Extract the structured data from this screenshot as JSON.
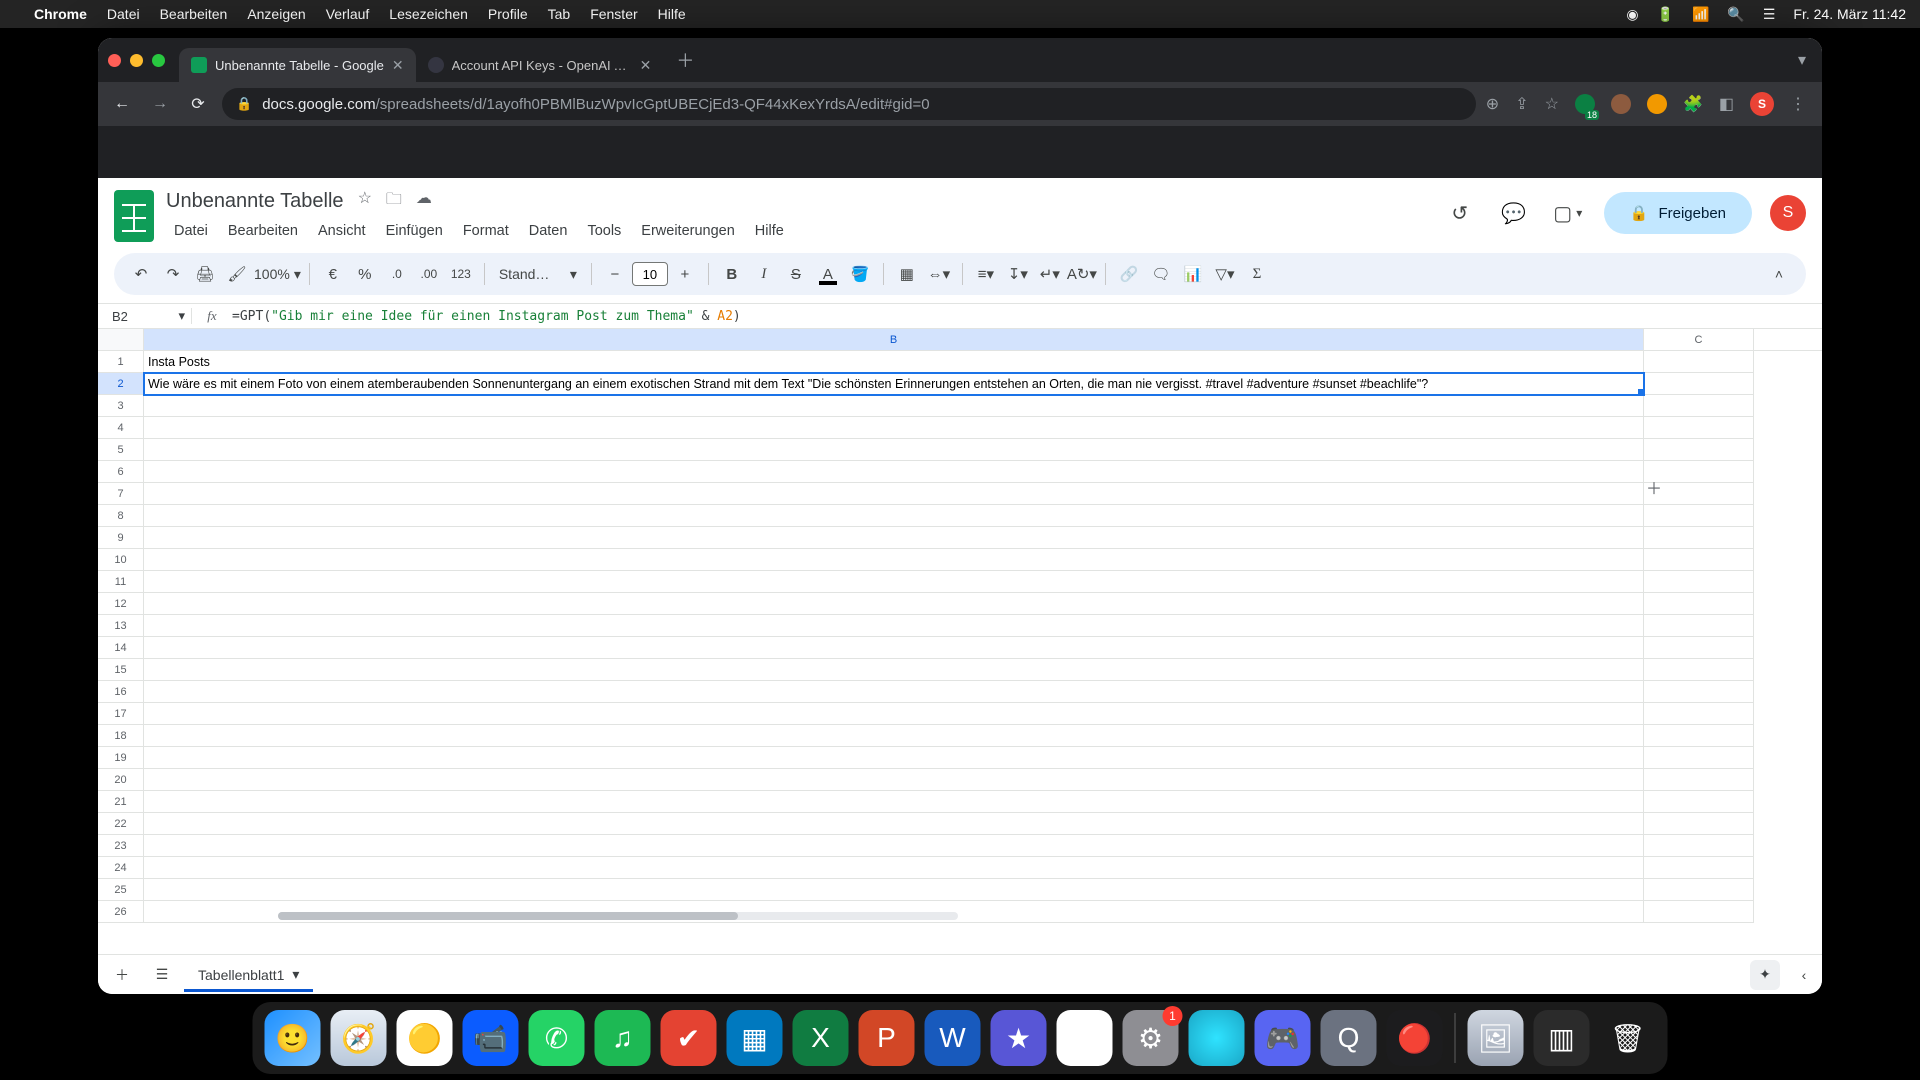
{
  "mac_menu": {
    "app": "Chrome",
    "items": [
      "Datei",
      "Bearbeiten",
      "Anzeigen",
      "Verlauf",
      "Lesezeichen",
      "Profile",
      "Tab",
      "Fenster",
      "Hilfe"
    ],
    "clock": "Fr. 24. März  11:42"
  },
  "chrome": {
    "tabs": [
      {
        "title": "Unbenannte Tabelle - Google",
        "active": true,
        "favicon": "sheets"
      },
      {
        "title": "Account API Keys - OpenAI API",
        "active": false,
        "favicon": "openai"
      }
    ],
    "url_domain": "docs.google.com",
    "url_path": "/spreadsheets/d/1ayofh0PBMlBuzWpvIcGptUBECjEd3-QF44xKexYrdsA/edit#gid=0",
    "ext_badge": "18",
    "profile_initial": "S"
  },
  "sheets": {
    "doc_title": "Unbenannte Tabelle",
    "menubar": [
      "Datei",
      "Bearbeiten",
      "Ansicht",
      "Einfügen",
      "Format",
      "Daten",
      "Tools",
      "Erweiterungen",
      "Hilfe"
    ],
    "share_label": "Freigeben",
    "profile_initial": "S",
    "toolbar": {
      "zoom": "100%",
      "currency": "€",
      "percent": "%",
      "dec_dec": ".0",
      "inc_dec": ".00",
      "one_two_three": "123",
      "font": "Stand…",
      "font_size": "10"
    },
    "name_box": "B2",
    "formula_prefix": "=",
    "formula_fn": "GPT",
    "formula_open": "(",
    "formula_string": "\"Gib mir eine Idee für einen Instagram Post zum Thema\"",
    "formula_concat": " & ",
    "formula_ref": "A2",
    "formula_close": ")",
    "columns": [
      "B",
      "C"
    ],
    "selected_col": "B",
    "selected_row": 2,
    "rows": [
      {
        "n": 1,
        "B": "Insta Posts",
        "C": ""
      },
      {
        "n": 2,
        "B": "Wie wäre es mit einem Foto von einem atemberaubenden Sonnenuntergang an einem exotischen Strand mit dem Text \"Die schönsten Erinnerungen entstehen an Orten, die man nie vergisst. #travel #adventure #sunset #beachlife\"?",
        "C": ""
      },
      {
        "n": 3,
        "B": "",
        "C": ""
      },
      {
        "n": 4,
        "B": "",
        "C": ""
      },
      {
        "n": 5,
        "B": "",
        "C": ""
      },
      {
        "n": 6,
        "B": "",
        "C": ""
      },
      {
        "n": 7,
        "B": "",
        "C": ""
      },
      {
        "n": 8,
        "B": "",
        "C": ""
      },
      {
        "n": 9,
        "B": "",
        "C": ""
      },
      {
        "n": 10,
        "B": "",
        "C": ""
      },
      {
        "n": 11,
        "B": "",
        "C": ""
      },
      {
        "n": 12,
        "B": "",
        "C": ""
      },
      {
        "n": 13,
        "B": "",
        "C": ""
      },
      {
        "n": 14,
        "B": "",
        "C": ""
      },
      {
        "n": 15,
        "B": "",
        "C": ""
      },
      {
        "n": 16,
        "B": "",
        "C": ""
      },
      {
        "n": 17,
        "B": "",
        "C": ""
      },
      {
        "n": 18,
        "B": "",
        "C": ""
      },
      {
        "n": 19,
        "B": "",
        "C": ""
      },
      {
        "n": 20,
        "B": "",
        "C": ""
      },
      {
        "n": 21,
        "B": "",
        "C": ""
      },
      {
        "n": 22,
        "B": "",
        "C": ""
      },
      {
        "n": 23,
        "B": "",
        "C": ""
      },
      {
        "n": 24,
        "B": "",
        "C": ""
      },
      {
        "n": 25,
        "B": "",
        "C": ""
      },
      {
        "n": 26,
        "B": "",
        "C": ""
      }
    ],
    "sheet_tab": "Tabellenblatt1"
  },
  "dock": {
    "apps": [
      {
        "name": "finder",
        "bg": "linear-gradient(135deg,#1e90ff,#74c0ff)",
        "glyph": "🙂"
      },
      {
        "name": "safari",
        "bg": "linear-gradient(#e8eef5,#b9c8da)",
        "glyph": "🧭"
      },
      {
        "name": "chrome",
        "bg": "#fff",
        "glyph": "🟡"
      },
      {
        "name": "zoom",
        "bg": "#0b5cff",
        "glyph": "📹"
      },
      {
        "name": "whatsapp",
        "bg": "#25d366",
        "glyph": "✆"
      },
      {
        "name": "spotify",
        "bg": "#1db954",
        "glyph": "♫"
      },
      {
        "name": "todoist",
        "bg": "#e44332",
        "glyph": "✔"
      },
      {
        "name": "trello",
        "bg": "#0079bf",
        "glyph": "▦"
      },
      {
        "name": "excel",
        "bg": "#107c41",
        "glyph": "X"
      },
      {
        "name": "powerpoint",
        "bg": "#d24726",
        "glyph": "P"
      },
      {
        "name": "word",
        "bg": "#185abd",
        "glyph": "W"
      },
      {
        "name": "imovie",
        "bg": "#5856d6",
        "glyph": "★"
      },
      {
        "name": "google-drive",
        "bg": "#fff",
        "glyph": "▲"
      },
      {
        "name": "settings",
        "bg": "#8e8e93",
        "glyph": "⚙",
        "badge": "1"
      },
      {
        "name": "siri",
        "bg": "radial-gradient(circle,#2fe3ff,#1aa7c7)",
        "glyph": ""
      },
      {
        "name": "discord",
        "bg": "#5865f2",
        "glyph": "🎮"
      },
      {
        "name": "quicktime",
        "bg": "#6b7280",
        "glyph": "Q"
      },
      {
        "name": "voice-memos",
        "bg": "#1c1c1e",
        "glyph": "🔴"
      }
    ],
    "right": [
      {
        "name": "preview",
        "bg": "linear-gradient(#cfd6e0,#9aa3b2)",
        "glyph": "🖼"
      },
      {
        "name": "mission-ctrl",
        "bg": "#2b2b2b",
        "glyph": "▥"
      },
      {
        "name": "trash",
        "bg": "transparent",
        "glyph": "🗑"
      }
    ]
  }
}
